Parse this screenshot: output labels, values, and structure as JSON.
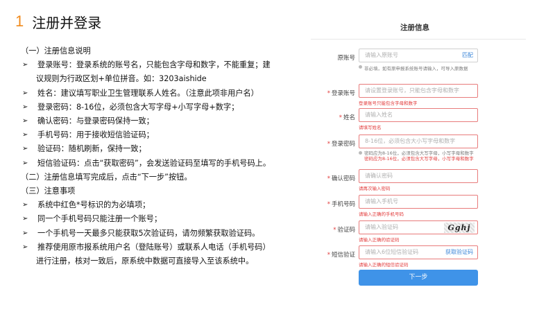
{
  "heading": {
    "number": "1",
    "title": "注册并登录"
  },
  "instructions": {
    "section1_title": "（一）注册信息说明",
    "items1": [
      {
        "lines": [
          "登录账号：登录系统的账号名，只能包含字母和数字，不能重复；建",
          "议规则为行政区划+单位拼音。如：3203aishide"
        ]
      },
      {
        "lines": [
          "姓名：建议填写职业卫生管理联系人姓名。（注意此项非用户名）"
        ]
      },
      {
        "lines": [
          "登录密码：8-16位，必须包含大写字母+小写字母+数字；"
        ]
      },
      {
        "lines": [
          "确认密码：与登录密码保持一致；"
        ]
      },
      {
        "lines": [
          "手机号码：用于接收短信验证码；"
        ]
      },
      {
        "lines": [
          "验证码：随机刷新，保持一致；"
        ]
      },
      {
        "lines": [
          "短信验证码：点击“获取密码”，会发送验证码至填写的手机号码上。"
        ]
      }
    ],
    "section2_title": "（二）注册信息填写完成后，点击“下一步”按钮。",
    "section3_title": "（三）注意事项",
    "items3": [
      {
        "lines": [
          "系统中红色*号标识的为必填项；"
        ]
      },
      {
        "lines": [
          "同一个手机号码只能注册一个账号；"
        ]
      },
      {
        "lines": [
          "一个手机号一天最多只能获取5次验证码，请勿频繁获取验证码。"
        ]
      },
      {
        "lines": [
          "推荐使用原市报系统用户名（登陆账号）或联系人电话（手机号码）",
          "进行注册，核对一致后，原系统中数据可直接导入至该系统中。"
        ]
      }
    ]
  },
  "form": {
    "title": "注册信息",
    "old_account": {
      "label": "原账号",
      "placeholder": "请输入原账号",
      "link": "匹配",
      "hint": "非必填，如有原申报系统账号请输入，可导入原数据"
    },
    "login_account": {
      "label": "登录账号",
      "placeholder": "请设置登录账号，只能包含字母和数字",
      "error": "登录账号只能包含字母和数字"
    },
    "name": {
      "label": "姓名",
      "placeholder": "请输入姓名",
      "error": "请填写姓名"
    },
    "password": {
      "label": "登录密码",
      "placeholder": "8-16位，必须包含大小写字母和数字",
      "hint": "密码应为8-16位，必须包含大写字母，小写字母和数字",
      "error": "密码应为8-16位，必须包含大写字母，小写字母和数字"
    },
    "confirm_password": {
      "label": "确认密码",
      "placeholder": "请确认密码",
      "error": "请再次输入密码"
    },
    "phone": {
      "label": "手机号码",
      "placeholder": "请输入手机号",
      "error": "请输入正确的手机号码"
    },
    "captcha": {
      "label": "验证码",
      "placeholder": "请输入验证码",
      "image_text": "Gghj",
      "error": "请输入正确的验证码"
    },
    "sms": {
      "label": "短信验证",
      "placeholder": "请输入6位短信验证码",
      "link": "获取验证码",
      "error": "请输入正确的短信验证码"
    },
    "submit_label": "下一步"
  },
  "colors": {
    "accent": "#3f93e8",
    "number": "#f08a1c",
    "error": "#e23b3b"
  }
}
